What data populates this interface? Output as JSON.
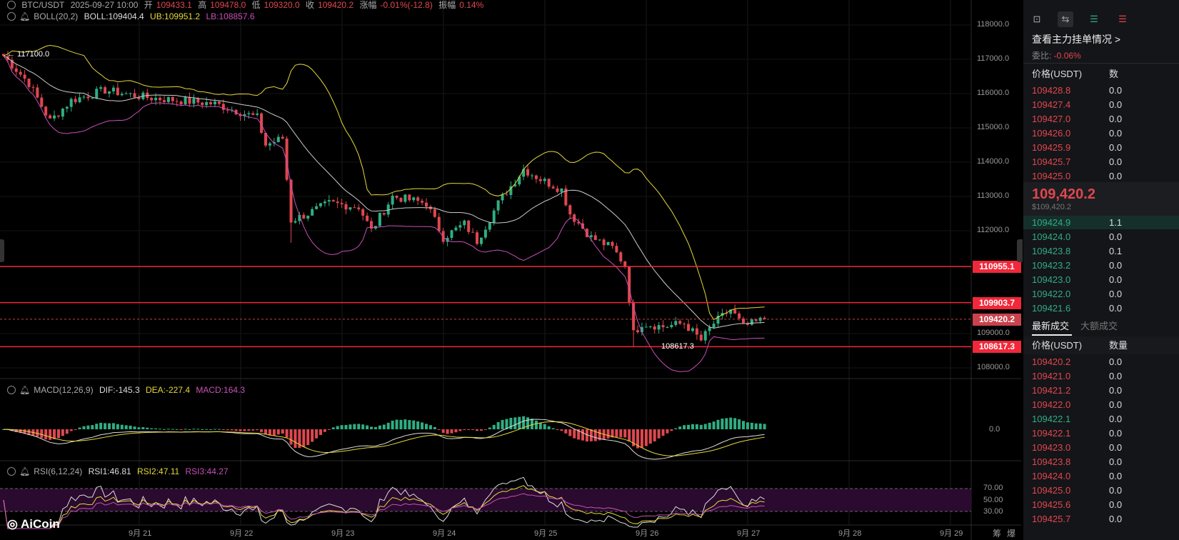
{
  "header": {
    "symbol": "BTC/USDT",
    "datetime": "2025-09-27 10:00",
    "open_label": "开",
    "open": "109433.1",
    "high_label": "高",
    "high": "109478.0",
    "low_label": "低",
    "low": "109320.0",
    "close_label": "收",
    "close": "109420.2",
    "change_label": "涨幅",
    "change": "-0.01%(-12.8)",
    "amp_label": "振幅",
    "amp": "0.14%"
  },
  "boll": {
    "name": "BOLL(20,2)",
    "boll": "BOLL:109404.4",
    "ub": "UB:109951.2",
    "lb": "LB:108857.6"
  },
  "macd": {
    "name": "MACD(12,26,9)",
    "dif": "DIF:-145.3",
    "dea": "DEA:-227.4",
    "macd": "MACD:164.3"
  },
  "rsi": {
    "name": "RSI(6,12,24)",
    "rsi1": "RSI1:46.81",
    "rsi2": "RSI2:47.11",
    "rsi3": "RSI3:44.27"
  },
  "annotations": {
    "high_mark": "← 117100.0",
    "low_mark": "108617.3"
  },
  "price_axis": [
    "118000.0",
    "117000.0",
    "116000.0",
    "115000.0",
    "114000.0",
    "113000.0",
    "112000.0",
    "109000.0",
    "108000.0"
  ],
  "price_axis_values": [
    118000,
    117000,
    116000,
    115000,
    114000,
    113000,
    112000,
    109000,
    108000
  ],
  "hlines": [
    {
      "value": 110955.1,
      "label": "110955.1"
    },
    {
      "value": 109903.7,
      "label": "109903.7"
    },
    {
      "value": 108617.3,
      "label": "108617.3"
    }
  ],
  "current_price": {
    "value": 109420.2,
    "label": "109420.2"
  },
  "macd_axis": "0.0",
  "rsi_axis": [
    "70.00",
    "50.00",
    "30.00"
  ],
  "dates": [
    "9月 21",
    "9月 22",
    "9月 23",
    "9月 24",
    "9月 25",
    "9月 26",
    "9月 27",
    "9月 28",
    "9月 29"
  ],
  "bottom_right": [
    "筹",
    "爆"
  ],
  "logo": "AiCoin",
  "colors": {
    "up": "#2fae84",
    "down": "#e0474f",
    "boll": "#cccccc",
    "ub": "#e5d83a",
    "lb": "#c850b8",
    "hline": "#f0283a"
  },
  "chart_data": {
    "type": "candlestick",
    "interval": "1h",
    "price_keypoints_hour_price": [
      [
        0,
        117100
      ],
      [
        6,
        116300
      ],
      [
        11,
        115200
      ],
      [
        16,
        115800
      ],
      [
        24,
        116100
      ],
      [
        33,
        115900
      ],
      [
        50,
        115700
      ],
      [
        60,
        115300
      ],
      [
        62,
        114500
      ],
      [
        66,
        114700
      ],
      [
        68,
        112300
      ],
      [
        72,
        112500
      ],
      [
        77,
        112800
      ],
      [
        84,
        112700
      ],
      [
        87,
        112000
      ],
      [
        92,
        113000
      ],
      [
        100,
        112800
      ],
      [
        104,
        111800
      ],
      [
        109,
        112200
      ],
      [
        112,
        111700
      ],
      [
        117,
        112800
      ],
      [
        123,
        113800
      ],
      [
        127,
        113500
      ],
      [
        132,
        113200
      ],
      [
        134,
        112500
      ],
      [
        139,
        111800
      ],
      [
        144,
        111500
      ],
      [
        147,
        111000
      ],
      [
        149,
        109000
      ],
      [
        151,
        109300
      ],
      [
        156,
        109200
      ],
      [
        161,
        109300
      ],
      [
        165,
        108800
      ],
      [
        168,
        109300
      ],
      [
        172,
        109700
      ],
      [
        175,
        109200
      ],
      [
        180,
        109420
      ]
    ]
  },
  "panel": {
    "title": "查看主力挂单情况 >",
    "ratio_label": "委比:",
    "ratio": "-0.06%",
    "col_price": "价格(USDT)",
    "col_qty": "数",
    "asks": [
      [
        "109428.8",
        "0.0"
      ],
      [
        "109427.4",
        "0.0"
      ],
      [
        "109427.0",
        "0.0"
      ],
      [
        "109426.0",
        "0.0"
      ],
      [
        "109425.9",
        "0.0"
      ],
      [
        "109425.7",
        "0.0"
      ],
      [
        "109425.0",
        "0.0"
      ]
    ],
    "last": "109,420.2",
    "last_usd": "$109,420.2",
    "bids": [
      [
        "109424.9",
        "1.1"
      ],
      [
        "109424.0",
        "0.0"
      ],
      [
        "109423.8",
        "0.1"
      ],
      [
        "109423.2",
        "0.0"
      ],
      [
        "109423.0",
        "0.0"
      ],
      [
        "109422.0",
        "0.0"
      ],
      [
        "109421.6",
        "0.0"
      ]
    ],
    "tab_latest": "最新成交",
    "tab_large": "大额成交",
    "col_qty2": "数量",
    "trades": [
      [
        "109420.2",
        "0.0",
        "s"
      ],
      [
        "109421.0",
        "0.0",
        "s"
      ],
      [
        "109421.2",
        "0.0",
        "s"
      ],
      [
        "109422.0",
        "0.0",
        "s"
      ],
      [
        "109422.1",
        "0.0",
        "b"
      ],
      [
        "109422.1",
        "0.0",
        "s"
      ],
      [
        "109423.0",
        "0.0",
        "s"
      ],
      [
        "109423.8",
        "0.0",
        "s"
      ],
      [
        "109424.0",
        "0.0",
        "s"
      ],
      [
        "109425.0",
        "0.0",
        "s"
      ],
      [
        "109425.6",
        "0.0",
        "s"
      ],
      [
        "109425.7",
        "0.0",
        "s"
      ]
    ]
  }
}
